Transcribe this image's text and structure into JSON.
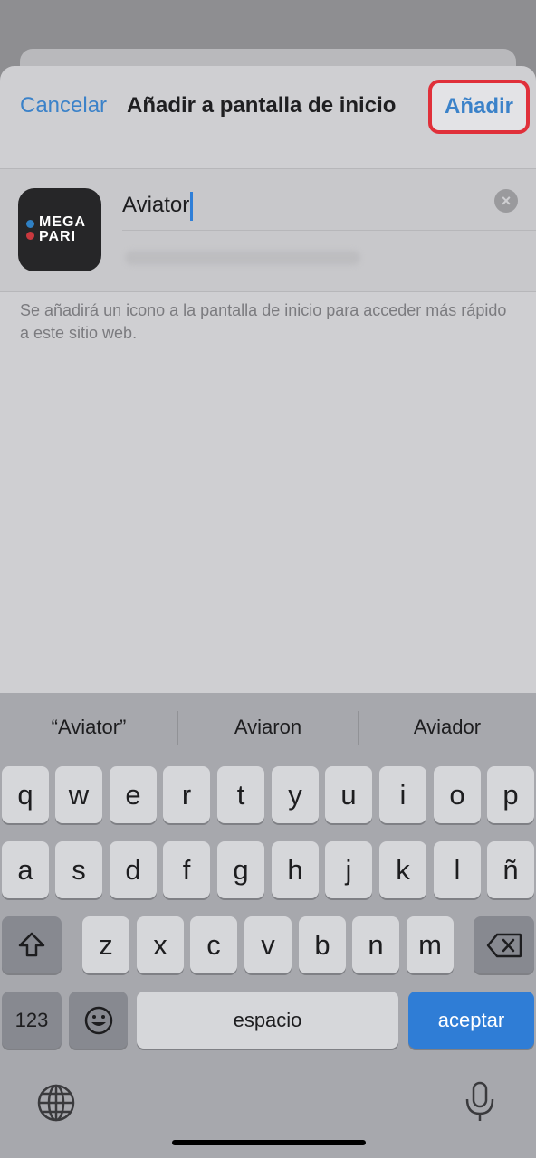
{
  "nav": {
    "cancel_label": "Cancelar",
    "title": "Añadir a pantalla de inicio",
    "add_label": "Añadir"
  },
  "app": {
    "icon_text": "MEGA\nPARI",
    "name_value": "Aviator",
    "hint": "Se añadirá un icono a la pantalla de inicio para acceder más rápido a este sitio web."
  },
  "keyboard": {
    "suggestions": [
      "“Aviator”",
      "Aviaron",
      "Aviador"
    ],
    "row1": [
      "q",
      "w",
      "e",
      "r",
      "t",
      "y",
      "u",
      "i",
      "o",
      "p"
    ],
    "row2": [
      "a",
      "s",
      "d",
      "f",
      "g",
      "h",
      "j",
      "k",
      "l",
      "ñ"
    ],
    "row3": [
      "z",
      "x",
      "c",
      "v",
      "b",
      "n",
      "m"
    ],
    "numbers_label": "123",
    "space_label": "espacio",
    "accept_label": "aceptar"
  },
  "colors": {
    "accent": "#3b82c9",
    "highlight": "#e0303a",
    "accept_key": "#2f7dd6"
  }
}
